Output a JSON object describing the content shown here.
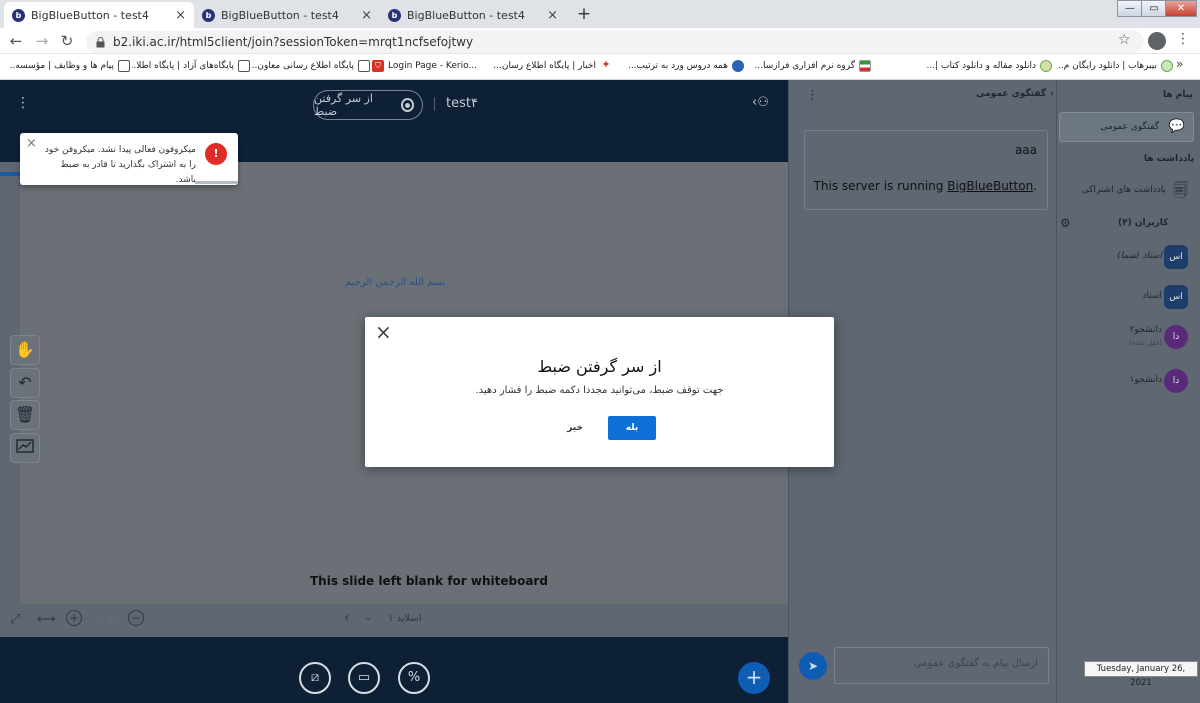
{
  "browser": {
    "tabs": [
      {
        "title": "BigBlueButton - test4",
        "close": "×"
      },
      {
        "title": "BigBlueButton - test4",
        "close": "×"
      },
      {
        "title": "BigBlueButton - test4",
        "close": "×"
      }
    ],
    "new_tab": "+",
    "window_controls": {
      "minimize": "—",
      "maximize": "▭",
      "close": "✕"
    },
    "url": "b2.iki.ac.ir/html5client/join?sessionToken=mrqt1ncfsefojtwy",
    "bookmarks_more": "»",
    "bookmarks": [
      {
        "label": "بیبرهاب | دانلود رایگان م..."
      },
      {
        "label": "دانلود مقاله و دانلود کتاب |..."
      },
      {
        "label": "گروه نرم افزاری فرازسا..."
      },
      {
        "label": "همه دروس ورد به ترتیب..."
      },
      {
        "label": "اخبار | پایگاه اطلاع رسان..."
      },
      {
        "label": "Login Page - Kerio..."
      },
      {
        "label": "پایگاه اطلاع رسانی معاون..."
      },
      {
        "label": "پایگاه‌های آزاد | پایگاه اطلا..."
      },
      {
        "label": "پیام ها و وظایف | مؤسسه..."
      }
    ]
  },
  "presentation": {
    "meeting_name": "test۴",
    "record_label": "از سر گرفتن ضبط",
    "slide_text": "بسم الله الرحمن الرحیم",
    "blank_slide": "This slide left blank for whiteboard",
    "slide_indicator": "اسلاید ۱",
    "zoom_value": "۱۰۰٪"
  },
  "toast": {
    "message": "میکروفون فعالی پیدا نشد. میکروفن خود را به اشتراک بگذارید تا قادر به ضبط باشد.",
    "close": "×",
    "icon": "!"
  },
  "modal": {
    "title": "از سر گرفتن ضبط",
    "description": "جهت توقف ضبط، می‌توانید مجددا دکمه ضبط را فشار دهید.",
    "confirm": "بله",
    "cancel": "خیر",
    "close": "×"
  },
  "chat": {
    "header": "گفتگوی عمومی",
    "message_line1": "aaa",
    "message_line2_prefix": "This server is running ",
    "message_link": "BigBlueButton",
    "message_line2_suffix": ".",
    "input_placeholder": "ارسال پیام به گفتگوی عمومی"
  },
  "userlist": {
    "messages_title": "پیام ها",
    "public_chat": "گفتگوی عمومی",
    "notes_title": "یادداشت ها",
    "shared_notes": "یادداشت های اشتراکی",
    "users_title": "کاربران (۴)",
    "users": [
      {
        "name": "استاد (شما)",
        "initials": "اس",
        "status": ""
      },
      {
        "name": "استاد",
        "initials": "اس",
        "status": ""
      },
      {
        "name": "دانشجو۲",
        "initials": "دا",
        "status": "(قفل شده)"
      },
      {
        "name": "دانشجو۱",
        "initials": "دا",
        "status": ""
      }
    ]
  },
  "taskbar": {
    "date": "Tuesday, January 26, 2021"
  },
  "colors": {
    "primary": "#0f70d7",
    "navy": "#0d2036",
    "danger": "#e02b28"
  }
}
